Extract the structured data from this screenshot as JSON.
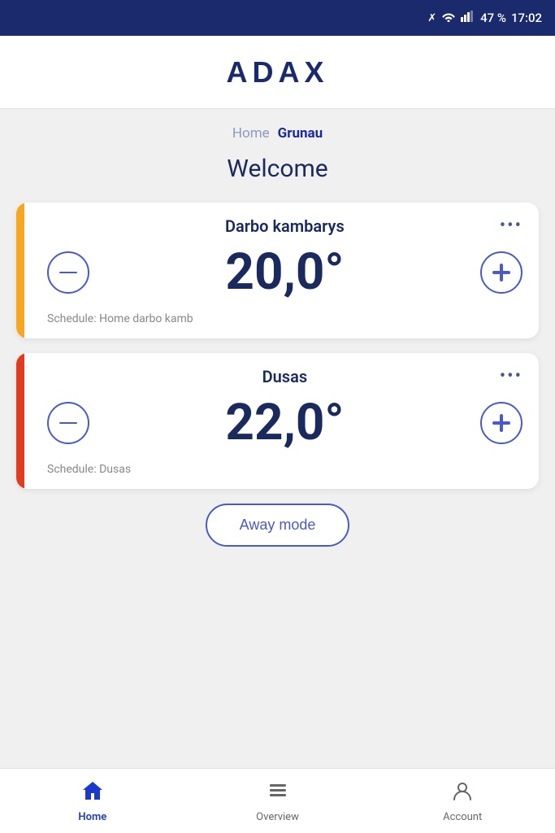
{
  "statusBar": {
    "battery": "47 %",
    "time": "17:02"
  },
  "header": {
    "logo": "ADAX"
  },
  "breadcrumb": {
    "inactive": "Home",
    "active": "Grunau"
  },
  "welcome": {
    "title": "Welcome"
  },
  "devices": [
    {
      "id": "device-1",
      "name": "Darbo kambarys",
      "temperature": "20,0°",
      "schedule": "Schedule: Home darbo kamb",
      "accentColor": "yellow"
    },
    {
      "id": "device-2",
      "name": "Dusas",
      "temperature": "22,0°",
      "schedule": "Schedule: Dusas",
      "accentColor": "red"
    }
  ],
  "awayMode": {
    "label": "Away mode"
  },
  "bottomNav": {
    "items": [
      {
        "id": "home",
        "label": "Home",
        "active": true
      },
      {
        "id": "overview",
        "label": "Overview",
        "active": false
      },
      {
        "id": "account",
        "label": "Account",
        "active": false
      }
    ]
  }
}
